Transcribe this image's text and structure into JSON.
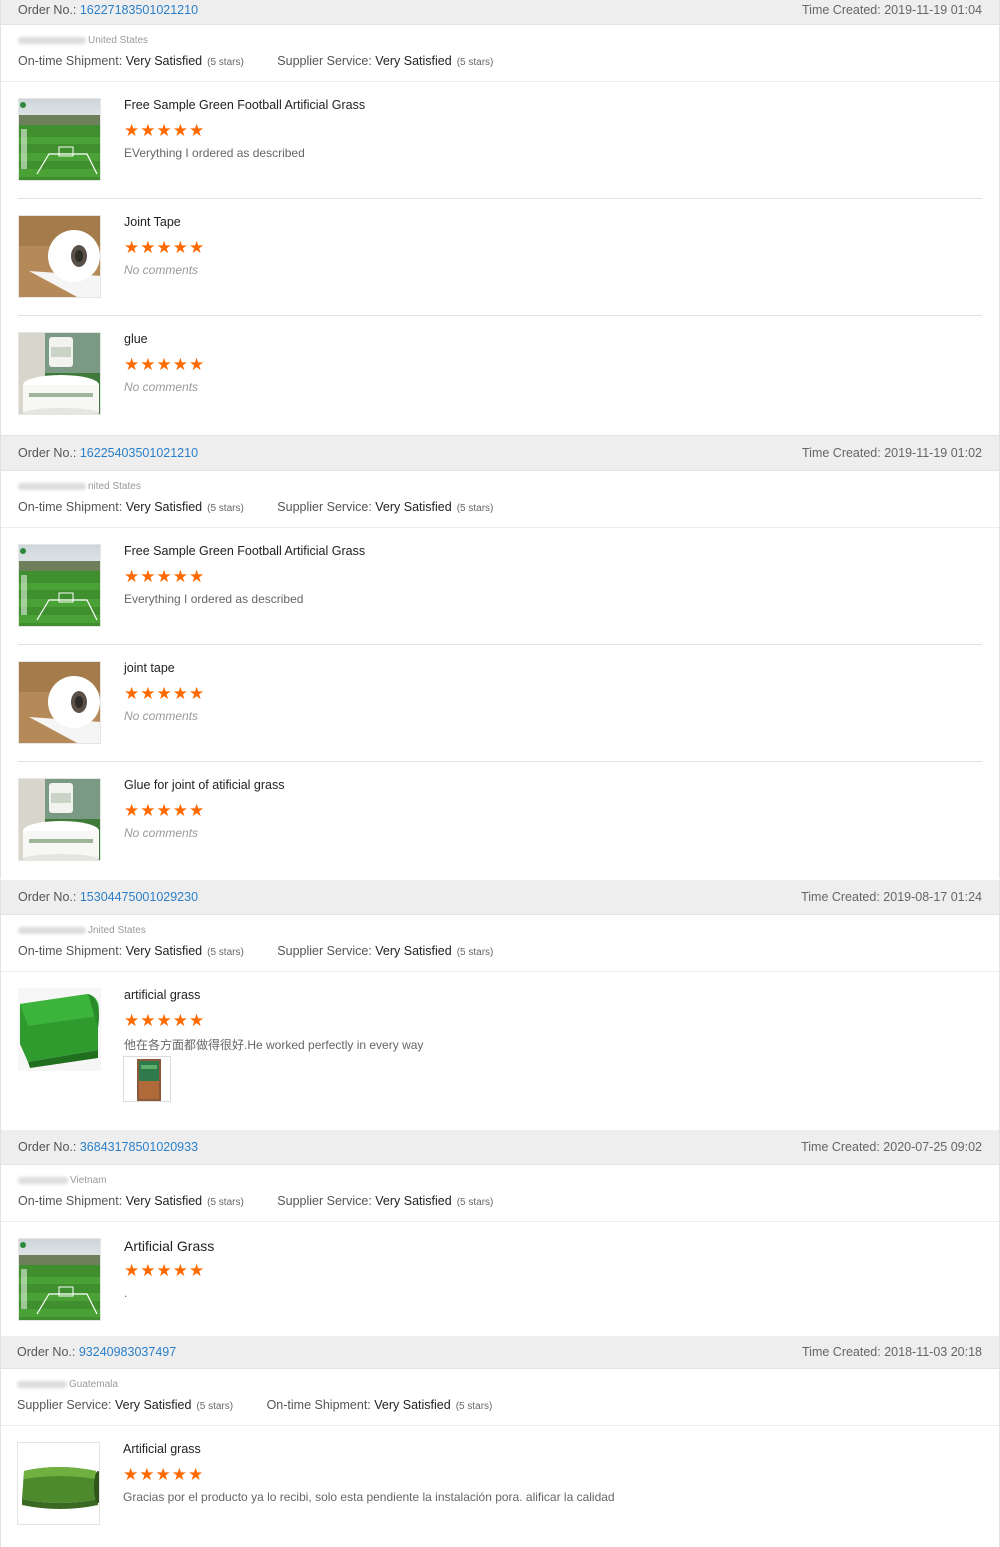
{
  "labels": {
    "order_no": "Order No.:",
    "time_created": "Time Created:",
    "ontime": "On-time Shipment:",
    "supplier": "Supplier Service:",
    "very_satisfied": "Very Satisfied",
    "five_stars": "(5 stars)",
    "no_comments": "No comments"
  },
  "colors": {
    "star": "#ff6a00",
    "order_link": "#2a7fc9",
    "header_bg": "#eeeeee"
  },
  "star_glyph": "★★★★★",
  "orders": [
    {
      "number": "16227183501021210",
      "time": "2019-11-19 01:04",
      "country": "United States",
      "reviews": [
        {
          "product": "Free Sample Green Football Artificial Grass",
          "stars": 5,
          "comment": "EVerything I ordered as described",
          "image": "football-field"
        },
        {
          "product": "Joint Tape",
          "stars": 5,
          "comment": "No comments",
          "image": "tape-roll"
        },
        {
          "product": "glue",
          "stars": 5,
          "comment": "No comments",
          "image": "glue-bucket"
        }
      ]
    },
    {
      "number": "16225403501021210",
      "time": "2019-11-19 01:02",
      "country": "nited States",
      "reviews": [
        {
          "product": "Free Sample Green Football Artificial Grass",
          "stars": 5,
          "comment": "Everything I ordered as described",
          "image": "football-field"
        },
        {
          "product": "joint tape",
          "stars": 5,
          "comment": "No comments",
          "image": "tape-roll"
        },
        {
          "product": "Glue for joint of atificial grass",
          "stars": 5,
          "comment": "No comments",
          "image": "glue-bucket"
        }
      ]
    },
    {
      "number": "15304475001029230",
      "time": "2019-08-17 01:24",
      "country": "Jnited States",
      "reviews": [
        {
          "product": "artificial grass",
          "stars": 5,
          "comment": "他在各方面都做得很好.He worked perfectly in every way",
          "image": "grass-roll"
        }
      ]
    },
    {
      "number": "36843178501020933",
      "time": "2020-07-25 09:02",
      "country": "Vietnam",
      "reviews": [
        {
          "product": "Artificial Grass",
          "stars": 5,
          "comment": ".",
          "image": "football-field"
        }
      ]
    },
    {
      "number": "93240983037497",
      "time": "2018-11-03 20:18",
      "country": "Guatemala",
      "reviews": [
        {
          "product": "Artificial grass",
          "stars": 5,
          "comment": "Gracias por el producto ya lo recibi, solo esta pendiente la instalación pora. alificar la calidad",
          "image": "grass-roll"
        }
      ]
    }
  ]
}
